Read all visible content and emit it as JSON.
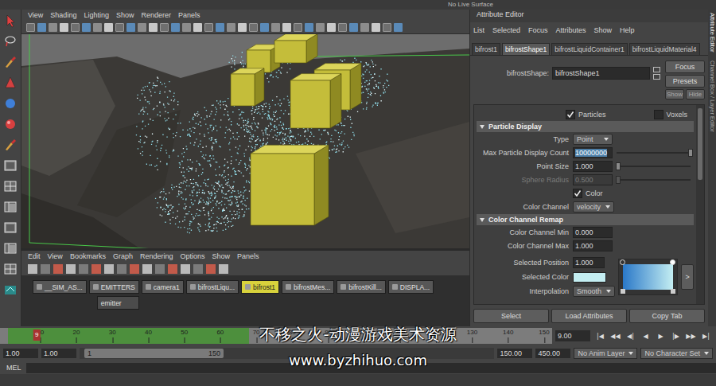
{
  "top_strip": {
    "text": "No Live Surface"
  },
  "viewport": {
    "menu": [
      "View",
      "Shading",
      "Lighting",
      "Show",
      "Renderer",
      "Panels"
    ]
  },
  "node_editor": {
    "menu": [
      "Edit",
      "View",
      "Bookmarks",
      "Graph",
      "Rendering",
      "Options",
      "Show",
      "Panels"
    ],
    "nodes": [
      {
        "label": "__SIM_AS...",
        "selected": false,
        "children": []
      },
      {
        "label": "EMITTERS",
        "selected": false,
        "children": [
          "emitter"
        ]
      },
      {
        "label": "camera1",
        "selected": false,
        "children": []
      },
      {
        "label": "bifrostLiqu...",
        "selected": false,
        "children": []
      },
      {
        "label": "bifrost1",
        "selected": true,
        "children": []
      },
      {
        "label": "bifrostMes...",
        "selected": false,
        "children": []
      },
      {
        "label": "bifrostKill...",
        "selected": false,
        "children": []
      },
      {
        "label": "DISPLA...",
        "selected": false,
        "children": []
      }
    ]
  },
  "attribute_editor": {
    "title": "Attribute Editor",
    "menu": [
      "List",
      "Selected",
      "Focus",
      "Attributes",
      "Show",
      "Help"
    ],
    "tabs": [
      {
        "label": "bifrost1",
        "selected": false
      },
      {
        "label": "bifrostShape1",
        "selected": true
      },
      {
        "label": "bifrostLiquidContainer1",
        "selected": false
      },
      {
        "label": "bifrostLiquidMaterial4",
        "selected": false
      }
    ],
    "shape_label": "bifrostShape:",
    "shape_value": "bifrostShape1",
    "side_buttons": [
      "Focus",
      "Presets"
    ],
    "small_buttons": [
      "Show",
      "Hide"
    ],
    "toggles": [
      {
        "label": "Particles",
        "checked": true
      },
      {
        "label": "Voxels",
        "checked": false
      }
    ],
    "sections": [
      {
        "title": "Particle Display",
        "expanded": true,
        "rows": [
          {
            "kind": "dropdown",
            "label": "Type",
            "value": "Point",
            "selected": false,
            "disabled": false
          },
          {
            "kind": "slider",
            "label": "Max Particle Display Count",
            "value": "10000000",
            "level": 1.0,
            "selected": true,
            "disabled": false
          },
          {
            "kind": "slider",
            "label": "Point Size",
            "value": "1.000",
            "level": 0.02,
            "selected": false,
            "disabled": false
          },
          {
            "kind": "slider",
            "label": "Sphere Radius",
            "value": "0.500",
            "level": 0.02,
            "selected": false,
            "disabled": true
          },
          {
            "kind": "checkbox",
            "label": "Color",
            "checked": true,
            "selected": false,
            "disabled": false
          },
          {
            "kind": "dropdown",
            "label": "Color Channel",
            "value": "velocity",
            "selected": false,
            "disabled": false
          }
        ]
      },
      {
        "title": "Color Channel Remap",
        "expanded": true,
        "rows": [
          {
            "kind": "field",
            "label": "Color Channel Min",
            "value": "0.000",
            "selected": false,
            "disabled": false
          },
          {
            "kind": "field",
            "label": "Color Channel Max",
            "value": "1.000",
            "selected": false,
            "disabled": false
          }
        ]
      }
    ],
    "ramp": {
      "position_label": "Selected Position",
      "position": "1.000",
      "color_label": "Selected Color",
      "color": "#c4eef2",
      "interp_label": "Interpolation",
      "interp": "Smooth",
      "expand": ">",
      "stops": [
        {
          "position": 0,
          "color": "#2a78c8",
          "selected": false
        },
        {
          "position": 1,
          "color": "#c4eef2",
          "selected": true
        }
      ]
    },
    "footer_buttons": [
      "Select",
      "Load Attributes",
      "Copy Tab"
    ]
  },
  "side_tabs": [
    {
      "label": "Attribute Editor",
      "selected": true
    },
    {
      "label": "Channel Box / Layer Editor",
      "selected": false
    }
  ],
  "timeline": {
    "start": "1",
    "end": "150",
    "current": "9",
    "cache_level": 0.45,
    "frame_field": "9.00",
    "ticks": [
      "10",
      "20",
      "30",
      "40",
      "50",
      "60",
      "70",
      "80",
      "90",
      "100",
      "110",
      "120",
      "130",
      "140",
      "150"
    ],
    "playback": [
      "|◀",
      "◀◀",
      "◀|",
      "◀",
      "▶",
      "|▶",
      "▶▶",
      "▶|"
    ]
  },
  "range": {
    "fields_left": [
      "1.00",
      "1.00"
    ],
    "bar_start": "1",
    "bar_end": "150",
    "fields_right": [
      "150.00",
      "450.00"
    ],
    "anim_layer": "No Anim Layer",
    "character_set": "No Character Set"
  },
  "command_line": {
    "label": "MEL"
  },
  "watermark": {
    "title": "不移之火-动漫游戏美术资源",
    "url": "www.byzhihuo.com"
  }
}
